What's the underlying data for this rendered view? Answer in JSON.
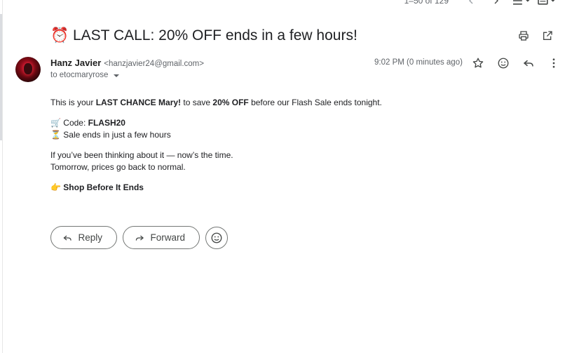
{
  "pager": {
    "text": "1–50 of 129"
  },
  "subject": {
    "text": "⏰ LAST CALL: 20% OFF ends in a few hours!"
  },
  "sender": {
    "name": "Hanz Javier",
    "email": "<hanzjavier24@gmail.com>",
    "to": "to etocmaryrose"
  },
  "time": {
    "text": "9:02 PM (0 minutes ago)"
  },
  "message": {
    "line1_pre": "This is your ",
    "line1_b1": "LAST CHANCE Mary!",
    "line1_mid": " to save ",
    "line1_b2": "20% OFF",
    "line1_post": " before our Flash Sale ends tonight.",
    "code_pre": "🛒 Code: ",
    "code_value": "FLASH20",
    "sale_ends": "⏳ Sale ends in just a few hours",
    "think_line": "If you’ve been thinking about it — now’s the time.",
    "tomorrow_line": "Tomorrow, prices go back to normal.",
    "cta_emoji": "👉 ",
    "cta_text": "Shop Before It Ends"
  },
  "actions": {
    "reply": "Reply",
    "forward": "Forward"
  },
  "icons": {
    "print": "print-icon",
    "open_new": "open-in-new-window-icon",
    "star": "star-icon",
    "emoji": "emoji-reaction-icon",
    "reply": "reply-icon",
    "more": "more-vert-icon",
    "prev": "chevron-left-icon",
    "next": "chevron-right-icon",
    "density": "density-icon",
    "keyboard": "input-tools-icon"
  }
}
